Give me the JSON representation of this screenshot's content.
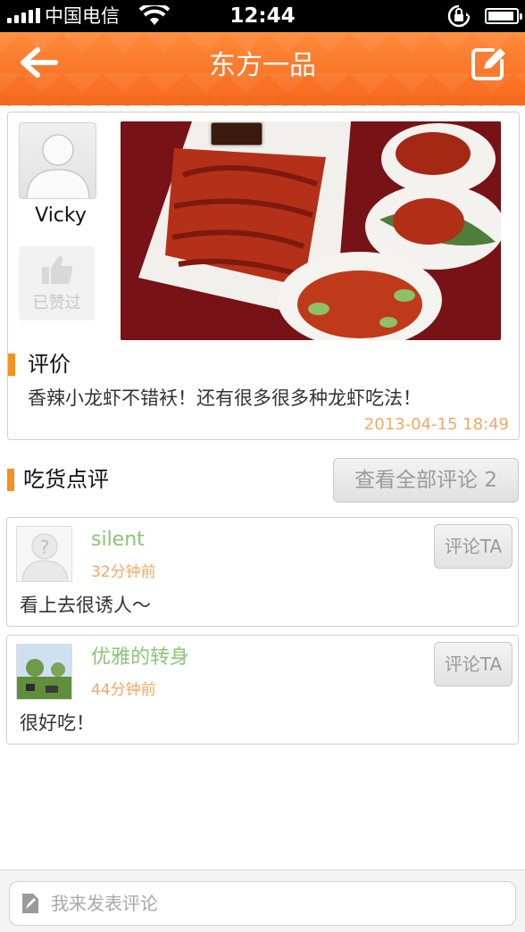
{
  "status_bar": {
    "carrier": "中国电信",
    "time": "12:44"
  },
  "nav": {
    "title": "东方一品",
    "back_icon": "arrow-left-icon",
    "edit_icon": "edit-icon"
  },
  "post": {
    "author": "Vicky",
    "liked_label": "已赞过",
    "review_heading": "评价",
    "review_text": "香辣小龙虾不错袄！还有很多很多种龙虾吃法！",
    "timestamp": "2013-04-15 18:49"
  },
  "comments_section": {
    "title": "吃货点评",
    "view_all_label": "查看全部评论 2"
  },
  "comments": [
    {
      "name": "silent",
      "time": "32分钟前",
      "text": "看上去很诱人～",
      "reply_label": "评论TA"
    },
    {
      "name": "优雅的转身",
      "time": "44分钟前",
      "text": "很好吃！",
      "reply_label": "评论TA"
    }
  ],
  "input": {
    "placeholder": "我来发表评论"
  },
  "colors": {
    "header": "#f6681d",
    "accent": "#f7901e",
    "username": "#8bc47a",
    "timestamp": "#f3a866"
  }
}
